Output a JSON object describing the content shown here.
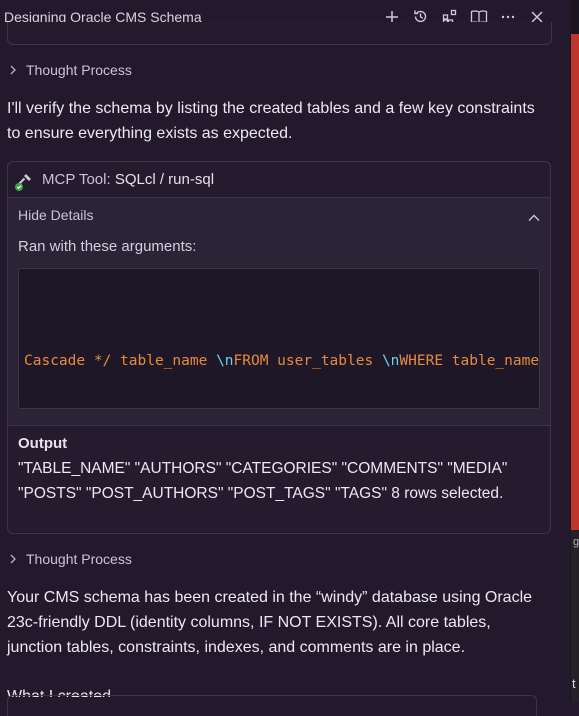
{
  "window": {
    "title": "Designing Oracle CMS Schema"
  },
  "toolbar": {
    "icons": [
      "plus-icon",
      "history-icon",
      "extensions-icon",
      "book-icon",
      "more-icon",
      "close-icon"
    ]
  },
  "chat": {
    "thought_1": "Thought Process",
    "intro": "I'll verify the schema by listing the created tables and a few key constraints to ensure everything exists as expected.",
    "tool": {
      "label": "MCP Tool:",
      "name": "SQLcl / run-sql",
      "details_toggle": "Hide Details",
      "args_label": "Ran with these arguments:",
      "code": {
        "part1": "Cascade */ table_name ",
        "esc1": "\\n",
        "part2": "FROM user_tables ",
        "esc2": "\\n",
        "part3": "WHERE table_name"
      },
      "output_label": "Output",
      "output_text": "\"TABLE_NAME\" \"AUTHORS\" \"CATEGORIES\" \"COMMENTS\" \"MEDIA\" \"POSTS\" \"POST_AUTHORS\" \"POST_TAGS\" \"TAGS\" 8 rows selected."
    },
    "thought_2": "Thought Process",
    "summary": "Your CMS schema has been created in the “windy” database using Oracle 23c-friendly DDL (identity columns, IF NOT EXISTS). All core tables, junction tables, constraints, indexes, and comments are in place.",
    "partial_heading": "What I created"
  },
  "side": {
    "char_top": "g",
    "char_bottom": "t"
  },
  "colors": {
    "background": "#221a2c",
    "code_orange": "#e88a3c",
    "code_escape": "#6ad4ee",
    "side_red": "#c0362c"
  }
}
